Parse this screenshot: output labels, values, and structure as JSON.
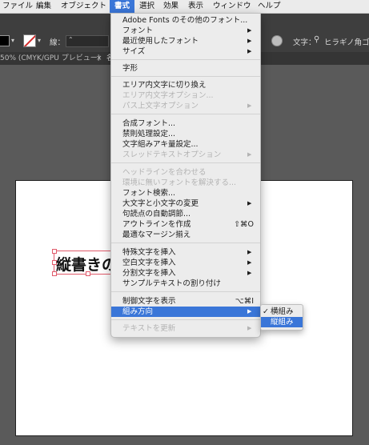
{
  "menubar": {
    "items": [
      "ファイル",
      "編集",
      "オブジェクト",
      "書式",
      "選択",
      "効果",
      "表示",
      "ウィンドウ",
      "ヘルプ"
    ],
    "active_index": 3
  },
  "control_bar": {
    "stroke_label": "線：",
    "font_label": "文字：",
    "font_value": "ヒラギノ角ゴ"
  },
  "doc_tabs": {
    "tab1": "50% (CMYK/GPU プレビュー)",
    "close1": "×",
    "tab2": "名"
  },
  "canvas": {
    "text_object": "縦書きの"
  },
  "type_menu": {
    "items": [
      {
        "label": "Adobe Fonts のその他のフォント...",
        "state": "enabled"
      },
      {
        "label": "フォント",
        "state": "enabled",
        "submenu": true
      },
      {
        "label": "最近使用したフォント",
        "state": "enabled",
        "submenu": true
      },
      {
        "label": "サイズ",
        "state": "enabled",
        "submenu": true
      },
      {
        "label": "字形",
        "state": "enabled"
      },
      {
        "label": "エリア内文字に切り換え",
        "state": "enabled"
      },
      {
        "label": "エリア内文字オプション...",
        "state": "disabled"
      },
      {
        "label": "パス上文字オプション",
        "state": "disabled",
        "submenu": true
      },
      {
        "label": "合成フォント...",
        "state": "enabled"
      },
      {
        "label": "禁則処理設定...",
        "state": "enabled"
      },
      {
        "label": "文字組みアキ量設定...",
        "state": "enabled"
      },
      {
        "label": "スレッドテキストオプション",
        "state": "disabled",
        "submenu": true
      },
      {
        "label": "ヘッドラインを合わせる",
        "state": "disabled"
      },
      {
        "label": "環境に無いフォントを解決する...",
        "state": "disabled"
      },
      {
        "label": "フォント検索...",
        "state": "enabled"
      },
      {
        "label": "大文字と小文字の変更",
        "state": "enabled",
        "submenu": true
      },
      {
        "label": "句読点の自動調節...",
        "state": "enabled"
      },
      {
        "label": "アウトラインを作成",
        "state": "enabled",
        "shortcut": "⇧⌘O"
      },
      {
        "label": "最適なマージン揃え",
        "state": "enabled"
      },
      {
        "label": "特殊文字を挿入",
        "state": "enabled",
        "submenu": true
      },
      {
        "label": "空白文字を挿入",
        "state": "enabled",
        "submenu": true
      },
      {
        "label": "分割文字を挿入",
        "state": "enabled",
        "submenu": true
      },
      {
        "label": "サンプルテキストの割り付け",
        "state": "enabled"
      },
      {
        "label": "制御文字を表示",
        "state": "enabled",
        "shortcut": "⌥⌘I"
      },
      {
        "label": "組み方向",
        "state": "highlighted",
        "submenu": true
      },
      {
        "label": "テキストを更新",
        "state": "disabled",
        "submenu": true
      }
    ],
    "arrow_glyph": "▶"
  },
  "orientation_submenu": {
    "horizontal": "横組み",
    "vertical": "縦組み",
    "check": "✓"
  },
  "colors": {
    "accent": "#3a76d8",
    "menu_bg": "#ececec",
    "disabled_text": "#b3b3b3"
  }
}
